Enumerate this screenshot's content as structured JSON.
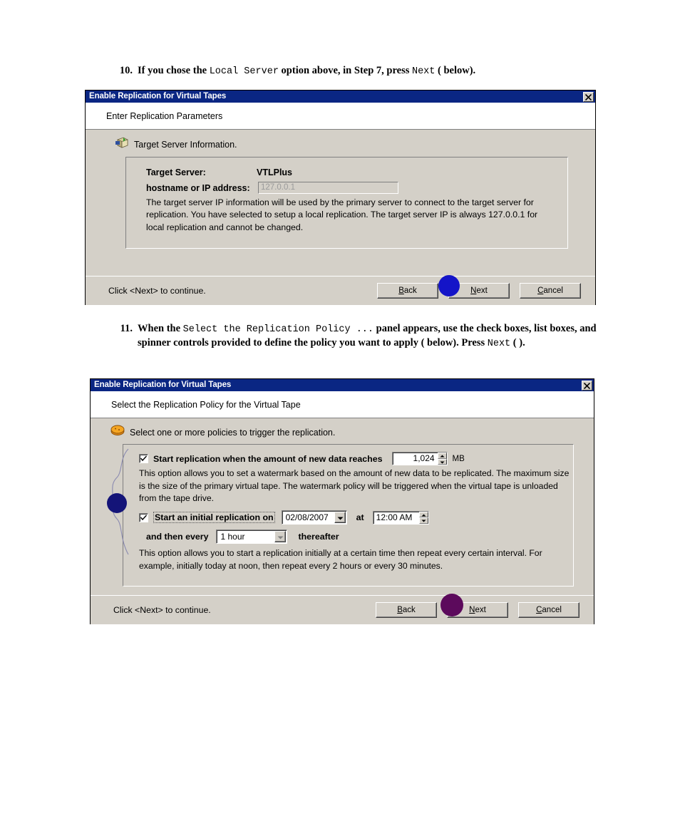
{
  "steps": [
    {
      "number": "10.",
      "segments": [
        {
          "text": "If you chose the ",
          "style": "bold"
        },
        {
          "text": "Local Server",
          "style": "mono"
        },
        {
          "text": " option above, in Step 7, press ",
          "style": "bold"
        },
        {
          "text": "Next",
          "style": "mono"
        },
        {
          "text": " (   below).",
          "style": "bold"
        }
      ]
    },
    {
      "number": "11.",
      "segments": [
        {
          "text": "When the ",
          "style": "bold"
        },
        {
          "text": "Select the Replication Policy ...",
          "style": "mono"
        },
        {
          "text": " panel appears, use the check boxes, list boxes, and spinner controls provided to define the policy you want to apply (   below). Press ",
          "style": "bold"
        },
        {
          "text": "Next",
          "style": "mono"
        },
        {
          "text": " (  ).",
          "style": "bold"
        }
      ]
    }
  ],
  "dialog1": {
    "title": "Enable Replication for Virtual Tapes",
    "close_icon": "close-icon",
    "subtitle": "Enter Replication Parameters",
    "headline_icon": "server-box-icon",
    "headline": "Target Server Information.",
    "target_server_label": "Target Server:",
    "target_server_value": "VTLPlus",
    "hostname_label": "hostname or IP address:",
    "hostname_value": "127.0.0.1",
    "description": "The target server IP information will be used by the primary server to connect to the target server for replication. You have selected to setup a local replication. The target server IP is always 127.0.0.1 for local replication and cannot be changed.",
    "footer_note": "Click <Next> to continue.",
    "buttons": [
      {
        "label": "Back",
        "accel": "B"
      },
      {
        "label": "Next",
        "accel": "N"
      },
      {
        "label": "Cancel",
        "accel": "C"
      }
    ],
    "marker_color": "#1414c8"
  },
  "dialog2": {
    "title": "Enable Replication for Virtual Tapes",
    "close_icon": "close-icon",
    "subtitle": "Select the Replication Policy for the Virtual Tape",
    "headline_icon": "policy-disk-icon",
    "headline": "Select one or more policies to trigger the replication.",
    "policy_watermark": {
      "checked": true,
      "label": "Start replication when the amount of new data reaches",
      "value": "1,024",
      "unit": "MB",
      "description": "This option allows you to set a watermark based on the amount of new data to be replicated. The maximum size is the size of the primary virtual tape. The watermark policy will be triggered when the virtual tape is unloaded from the tape drive."
    },
    "policy_schedule": {
      "checked": true,
      "label": "Start an initial replication on",
      "date_value": "02/08/2007",
      "at_label": "at",
      "time_value": "12:00 AM",
      "every_label": "and then every",
      "interval_value": "1 hour",
      "thereafter_label": "thereafter",
      "description": "This option allows you to start a replication initially at a certain time then repeat every certain interval. For example, initially today at noon, then repeat every 2 hours or every 30 minutes."
    },
    "footer_note": "Click <Next> to continue.",
    "buttons": [
      {
        "label": "Back",
        "accel": "B"
      },
      {
        "label": "Next",
        "accel": "N"
      },
      {
        "label": "Cancel",
        "accel": "C"
      }
    ],
    "marker_color": "#5c0a5c",
    "side_marker_color": "#141478"
  }
}
